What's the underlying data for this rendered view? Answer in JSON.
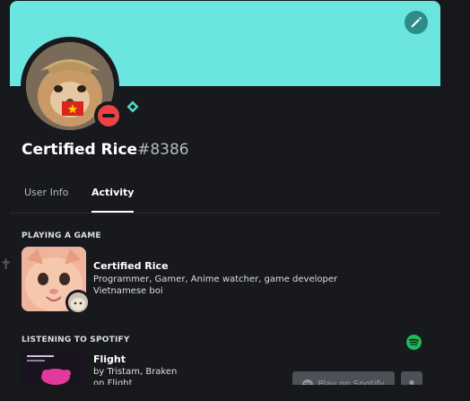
{
  "profile": {
    "username": "Certified Rice",
    "discriminator": "#8386",
    "banner_color": "#6ae5df",
    "status": "do-not-disturb",
    "status_color": "#ed4245"
  },
  "tabs": [
    {
      "label": "User Info",
      "active": false
    },
    {
      "label": "Activity",
      "active": true
    }
  ],
  "game": {
    "section_title": "PLAYING A GAME",
    "name": "Certified Rice",
    "details": "Programmer, Gamer, Anime watcher, game developer",
    "state": "Vietnamese boi"
  },
  "spotify": {
    "section_title": "LISTENING TO SPOTIFY",
    "song": "Flight",
    "artist": "by Tristam, Braken",
    "album": "on Flight",
    "play_label": "Play on Spotify",
    "brand_color": "#1db954"
  },
  "icons": {
    "edit": "pencil-icon",
    "status": "dnd-status-icon",
    "badge": "nitro-badge-icon",
    "spotify": "spotify-icon",
    "profile": "user-icon"
  }
}
